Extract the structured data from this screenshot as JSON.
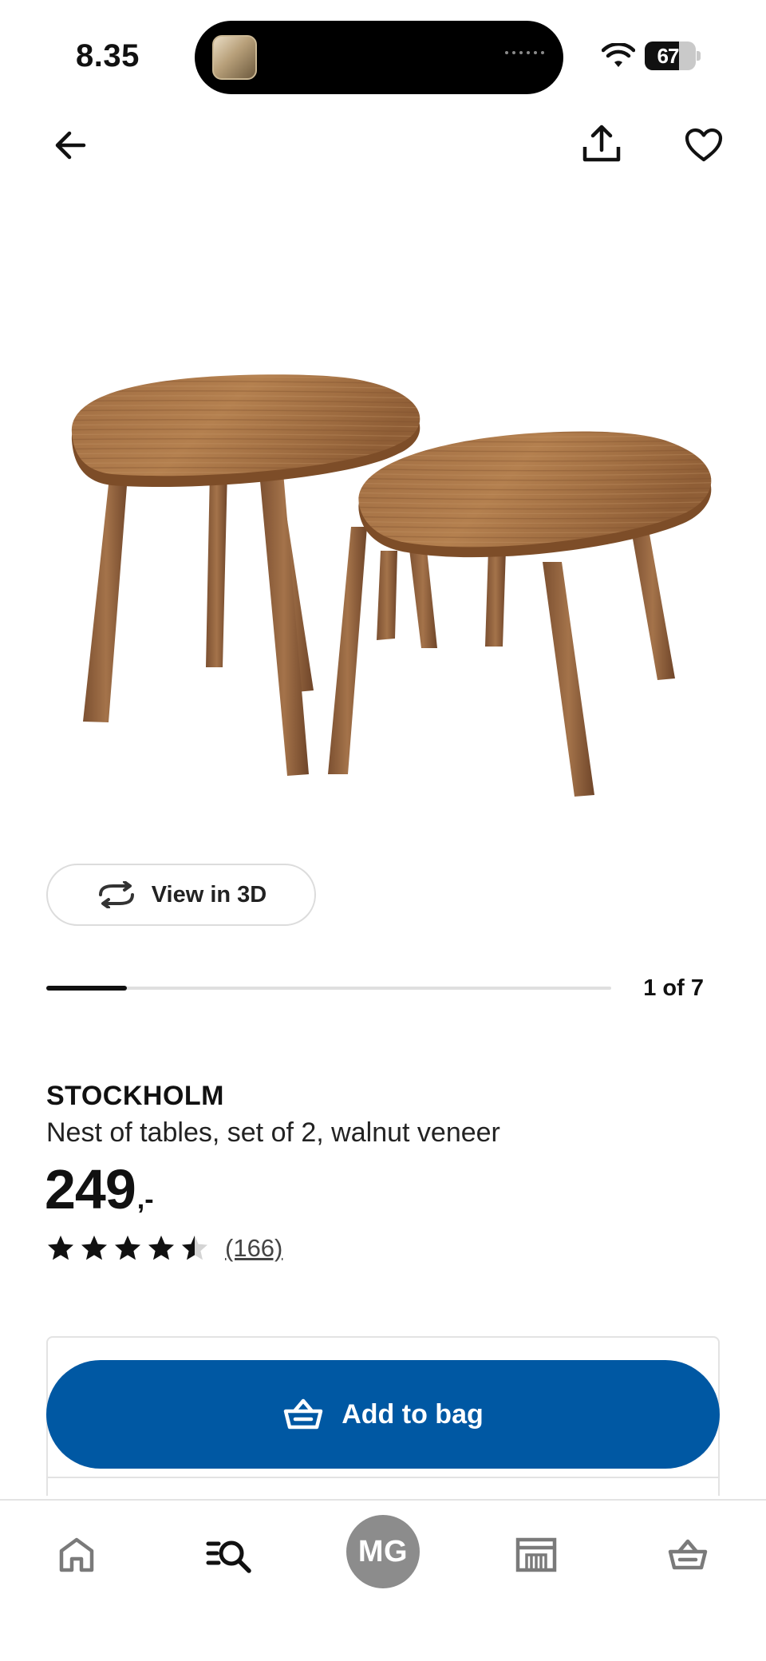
{
  "status_bar": {
    "time": "8.35",
    "battery_level": "67",
    "battery_fraction": 0.67
  },
  "nav": {
    "back_icon": "arrow-left-icon",
    "share_icon": "share-icon",
    "favorite_icon": "heart-icon"
  },
  "gallery": {
    "view3d_label": "View in 3D",
    "view3d_icon": "rotate-3d-icon",
    "counter": "1 of 7",
    "progress_fraction": 0.142857
  },
  "product": {
    "name": "STOCKHOLM",
    "description": "Nest of tables, set of 2, walnut veneer",
    "price_integer": "249",
    "price_suffix": ",-",
    "rating_value": 4.5,
    "rating_max": 5,
    "review_count": "(166)"
  },
  "actions": {
    "add_to_bag_label": "Add to bag",
    "add_to_bag_icon": "shopping-basket-icon"
  },
  "tab_bar": {
    "home_icon": "home-icon",
    "search_icon": "search-list-icon",
    "profile_initials": "MG",
    "stores_icon": "store-icon",
    "bag_icon": "shopping-basket-icon"
  },
  "colors": {
    "primary_blue": "#0058a3",
    "text": "#111111",
    "avatar_gray": "#8c8c8c",
    "wood": "#9b6a3e"
  }
}
